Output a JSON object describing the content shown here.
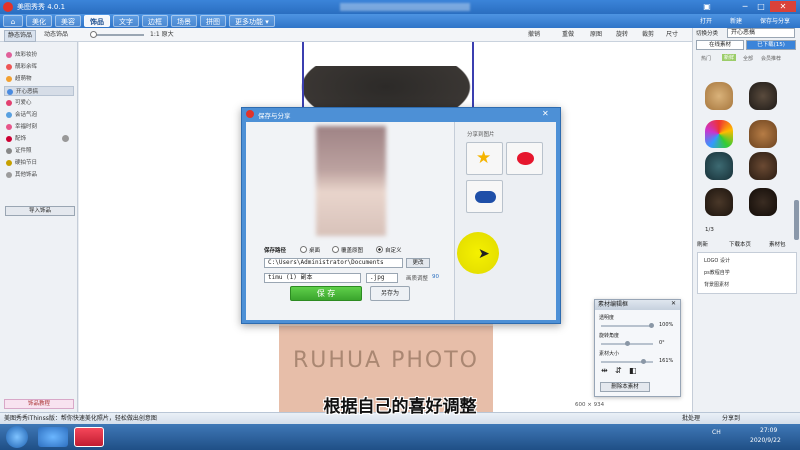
{
  "app": {
    "title": "美图秀秀 4.0.1",
    "top_right": [
      "打开",
      "新建",
      "保存与分享"
    ]
  },
  "menu": {
    "tabs": [
      "美化",
      "美容",
      "饰品",
      "文字",
      "边框",
      "场景",
      "拼图",
      "更多功能 ▾"
    ],
    "active": "饰品"
  },
  "toolbar": {
    "left": [
      "静态饰品",
      "动态饰品"
    ],
    "zoom": "1:1 原大",
    "actions": [
      "撤销",
      "重做",
      "原图",
      "旋转",
      "裁剪",
      "尺寸"
    ]
  },
  "sidebar": {
    "items": [
      "炫彩妆扮",
      "靓彩余晖",
      "超萌物",
      "开心恶搞",
      "可爱心",
      "会话气泡",
      "幸福时刻",
      "配饰",
      "证件照",
      "硬拍节日",
      "其他饰品"
    ],
    "selected_index": 3,
    "import_button": "导入饰品",
    "bottom_button": "饰品教程"
  },
  "canvas": {
    "photo_text": "RUHUA PHOTO",
    "size_readout": "600 × 934"
  },
  "dialog": {
    "title": "保存与分享",
    "share_heading": "分享到图片",
    "path_label": "保存路径",
    "path_options": [
      "桌面",
      "覆盖原图",
      "自定义"
    ],
    "path_value": "C:\\Users\\Administrator\\Documents",
    "browse": "更改",
    "filename": "timu (1) 副本",
    "format": ".jpg",
    "quality_label": "画质调整",
    "quality_value": "90",
    "save_button": "保 存",
    "save_as_button": "另存为"
  },
  "right_panel": {
    "header": "切换分类",
    "category": "开心恶搞",
    "tabs": [
      "在线素材",
      "已下载(15)"
    ],
    "subtabs": [
      "热门",
      "新鲜",
      "全部",
      "会员推荐"
    ],
    "pager": "1/3",
    "buttons": [
      "刷新",
      "下载本页",
      "素材包"
    ],
    "links": [
      "LOGO 设计",
      "ps教程自学",
      "背景图素材"
    ]
  },
  "material_panel": {
    "title": "素材编辑框",
    "opacity_label": "透明度",
    "opacity_value": "100%",
    "rotate_label": "旋转角度",
    "rotate_value": "0°",
    "size_label": "素材大小",
    "size_value": "161%",
    "delete_button": "删除本素材"
  },
  "statusbar": {
    "tip": "美图秀秀iThinss版：帮你快速美化照片，轻松做出创意图",
    "right": [
      "批处理",
      "分享到"
    ]
  },
  "subtitle": "根据自己的喜好调整",
  "taskbar": {
    "lang": "CH",
    "time": "27:09",
    "date": "2020/9/22"
  }
}
